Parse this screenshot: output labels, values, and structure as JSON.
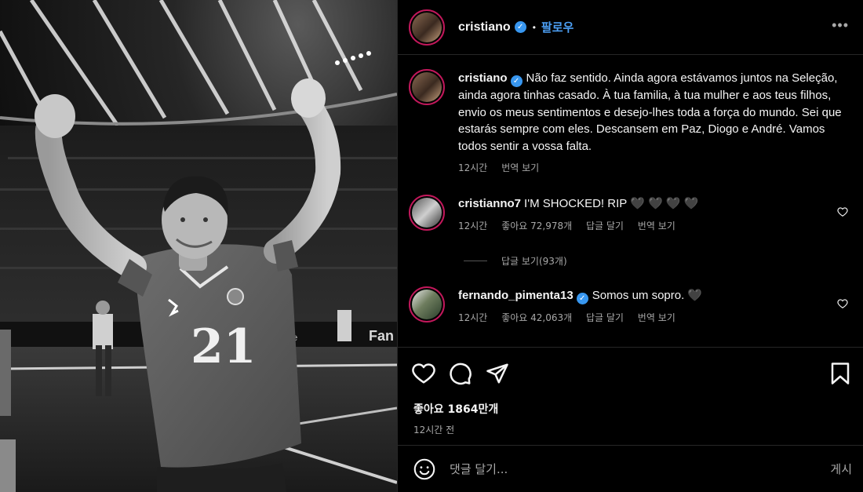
{
  "post": {
    "username": "cristiano",
    "follow_label": "팔로우",
    "dot": "•",
    "more_label": "•••",
    "caption_user": "cristiano",
    "caption": "Não faz sentido. Ainda agora estávamos juntos na Seleção, ainda agora tinhas casado. À tua familia, à tua mulher e aos teus filhos, envio os meus sentimentos e desejo-lhes toda a força do mundo. Sei que estarás sempre com eles. Descansem em Paz, Diogo e André. Vamos todos sentir a vossa falta.",
    "caption_time": "12시간",
    "caption_translate": "번역 보기",
    "jersey_number": "21"
  },
  "comments": [
    {
      "username": "cristianno7",
      "text": "I'M SHOCKED! RIP 🖤 🖤 🖤 🖤",
      "time": "12시간",
      "likes": "좋아요 72,978개",
      "reply": "답글 달기",
      "translate": "번역 보기",
      "view_replies": "답글 보기(93개)"
    },
    {
      "username": "fernando_pimenta13",
      "text": "Somos um sopro. 🖤",
      "time": "12시간",
      "likes": "좋아요 42,063개",
      "reply": "답글 달기",
      "translate": "번역 보기"
    }
  ],
  "actions": {
    "like_icon": "heart-icon",
    "comment_icon": "comment-icon",
    "share_icon": "share-icon",
    "save_icon": "bookmark-icon",
    "likes_count": "좋아요 1864만개",
    "posted_time": "12시간 전"
  },
  "composer": {
    "placeholder": "댓글 달기...",
    "post_label": "게시",
    "emoji_icon": "emoji-icon"
  },
  "colors": {
    "background": "#000000",
    "text": "#f5f5f5",
    "muted": "#a8a8a8",
    "accent": "#4c9ff4",
    "verified": "#3897f0",
    "border": "#262626"
  }
}
